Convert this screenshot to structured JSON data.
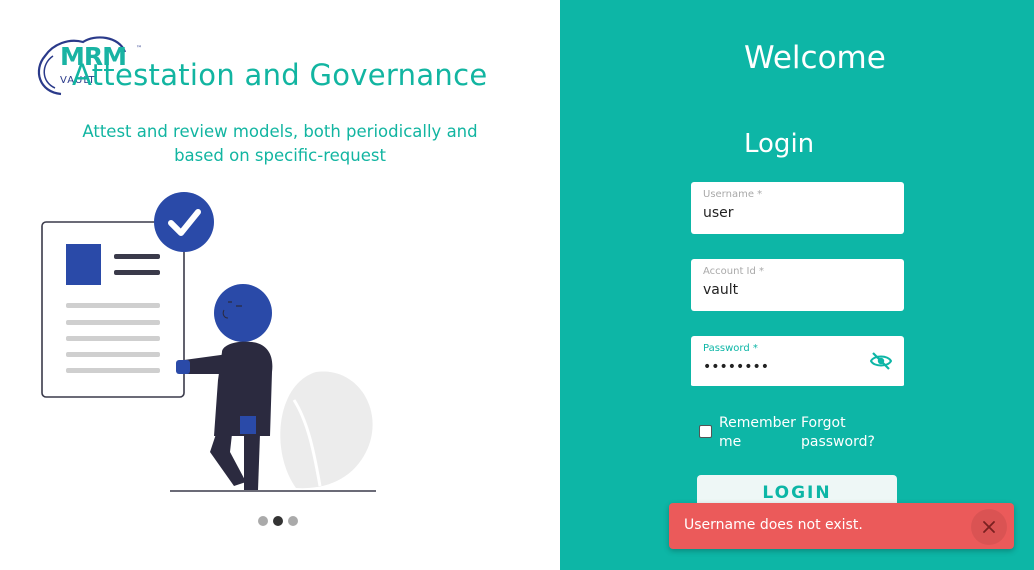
{
  "brand": {
    "name": "MRM",
    "sub": "VAULT",
    "tm": "™"
  },
  "carousel": {
    "title": "Attestation and Governance",
    "subtitle": "Attest and review models, both periodically and based on specific-request",
    "slides": 3,
    "active_slide": 2
  },
  "login": {
    "welcome": "Welcome",
    "heading": "Login",
    "username": {
      "label": "Username *",
      "value": "user"
    },
    "account": {
      "label": "Account Id *",
      "value": "vault"
    },
    "password": {
      "label": "Password *",
      "value": "••••••••",
      "toggle_icon": "eye-off-icon"
    },
    "remember_label": "Remember me",
    "remember_checked": false,
    "forgot_label": "Forgot password?",
    "submit_label": "LOGIN"
  },
  "toast": {
    "message": "Username does not exist.",
    "close_icon": "close-icon"
  },
  "colors": {
    "accent": "#0db6a6",
    "error": "#eb5a5a",
    "navy": "#2a4aa8",
    "dark": "#2b2a3f"
  }
}
